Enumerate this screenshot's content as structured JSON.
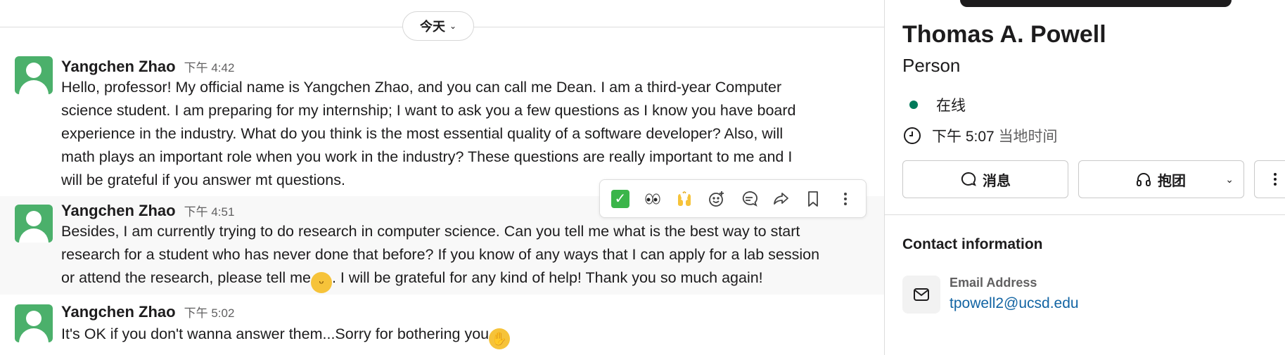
{
  "chat": {
    "day_divider": "今天",
    "messages": [
      {
        "author": "Yangchen Zhao",
        "time": "下午 4:42",
        "lines": [
          "Hello, professor! My official name is Yangchen Zhao, and you can call me Dean. I am a third-year Computer",
          "science student. I am preparing for my internship; I want to ask you a few questions as I know you have board",
          "experience in the industry. What do you think is the most essential quality of a software developer? Also, will",
          "math plays an important role when you work in the industry? These questions are really important to me and I",
          "will be grateful if you answer mt questions."
        ]
      },
      {
        "author": "Yangchen Zhao",
        "time": "下午 4:51",
        "lines": [
          "Besides, I am currently trying to do research in computer science. Can you tell me what is the best way to start",
          "research for a student who has never done that before? If you know of any ways that I can apply for a lab session"
        ],
        "line3_before_emoji": "or attend the research, please tell me",
        "line3_after_emoji": ". I will be grateful for any kind of help! Thank you so much again!",
        "emoji": "grinning-face"
      },
      {
        "author": "Yangchen Zhao",
        "time": "下午 5:02",
        "line_before_emoji": "It's OK if you don't wanna answer them...Sorry for bothering you",
        "emoji": "face-with-hand-over-mouth"
      }
    ],
    "toolbar": [
      "completed-reaction",
      "eyes-reaction",
      "raised-hands-reaction",
      "add-reaction",
      "reply-in-thread",
      "share-message",
      "save-for-later",
      "more-actions"
    ]
  },
  "profile": {
    "name": "Thomas A. Powell",
    "role": "Person",
    "status": "在线",
    "local_time_value": "下午 5:07",
    "local_time_suffix": "当地时间",
    "message_button": "消息",
    "huddle_button": "抱团",
    "contact_title": "Contact information",
    "email_label": "Email Address",
    "email_value": "tpowell2@ucsd.edu"
  },
  "colors": {
    "status_online": "#007a5a",
    "link": "#1264a3",
    "avatar": "#4bb06b"
  }
}
